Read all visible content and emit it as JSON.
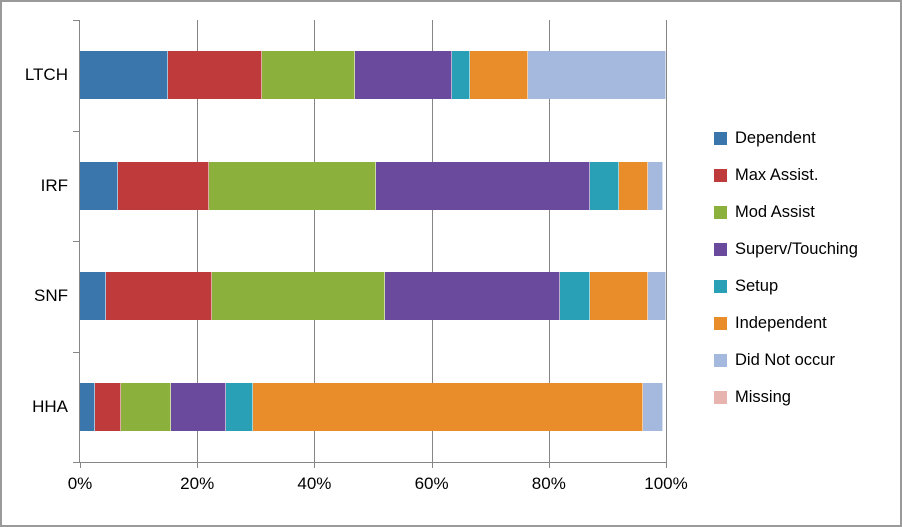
{
  "chart_data": {
    "type": "bar",
    "orientation": "horizontal",
    "stacked": true,
    "normalized": true,
    "title": "",
    "xlabel": "",
    "ylabel": "",
    "xlim": [
      0,
      100
    ],
    "x_ticks": [
      "0%",
      "20%",
      "40%",
      "60%",
      "80%",
      "100%"
    ],
    "x_tick_values": [
      0,
      20,
      40,
      60,
      80,
      100
    ],
    "grid": "vertical",
    "legend_position": "right",
    "categories": [
      "LTCH",
      "IRF",
      "SNF",
      "HHA"
    ],
    "series": [
      {
        "name": "Dependent",
        "color": "#3a76ab",
        "values": [
          15.0,
          6.5,
          4.5,
          2.5
        ]
      },
      {
        "name": "Max Assist.",
        "color": "#bf3b3b",
        "values": [
          16.0,
          15.5,
          18.0,
          4.5
        ]
      },
      {
        "name": "Mod Assist",
        "color": "#8cb03c",
        "values": [
          16.0,
          28.5,
          29.5,
          8.5
        ]
      },
      {
        "name": "Superv/Touching",
        "color": "#6a4a9c",
        "values": [
          16.5,
          36.5,
          30.0,
          9.5
        ]
      },
      {
        "name": "Setup",
        "color": "#29a0b5",
        "values": [
          3.0,
          5.0,
          5.0,
          4.5
        ]
      },
      {
        "name": "Independent",
        "color": "#e88d2a",
        "values": [
          10.0,
          5.0,
          10.0,
          66.5
        ]
      },
      {
        "name": "Did Not occur",
        "color": "#a5b8dd",
        "values": [
          23.5,
          2.5,
          3.0,
          3.5
        ]
      },
      {
        "name": "Missing",
        "color": "#e8b4b0",
        "values": [
          0.0,
          0.0,
          0.0,
          0.0
        ]
      }
    ]
  },
  "axis": {
    "x_labels": [
      "0%",
      "20%",
      "40%",
      "60%",
      "80%",
      "100%"
    ],
    "y_labels": [
      "LTCH",
      "IRF",
      "SNF",
      "HHA"
    ]
  },
  "legend": {
    "items": [
      {
        "label": "Dependent",
        "color": "#3a76ab"
      },
      {
        "label": "Max Assist.",
        "color": "#bf3b3b"
      },
      {
        "label": "Mod Assist",
        "color": "#8cb03c"
      },
      {
        "label": "Superv/Touching",
        "color": "#6a4a9c"
      },
      {
        "label": "Setup",
        "color": "#29a0b5"
      },
      {
        "label": "Independent",
        "color": "#e88d2a"
      },
      {
        "label": "Did Not occur",
        "color": "#a5b8dd"
      },
      {
        "label": "Missing",
        "color": "#e8b4b0"
      }
    ]
  },
  "style": {
    "border_color": "#9a9a9a",
    "grid_color": "#868686",
    "axis_color": "#868686",
    "plot_background": "#ffffff"
  }
}
